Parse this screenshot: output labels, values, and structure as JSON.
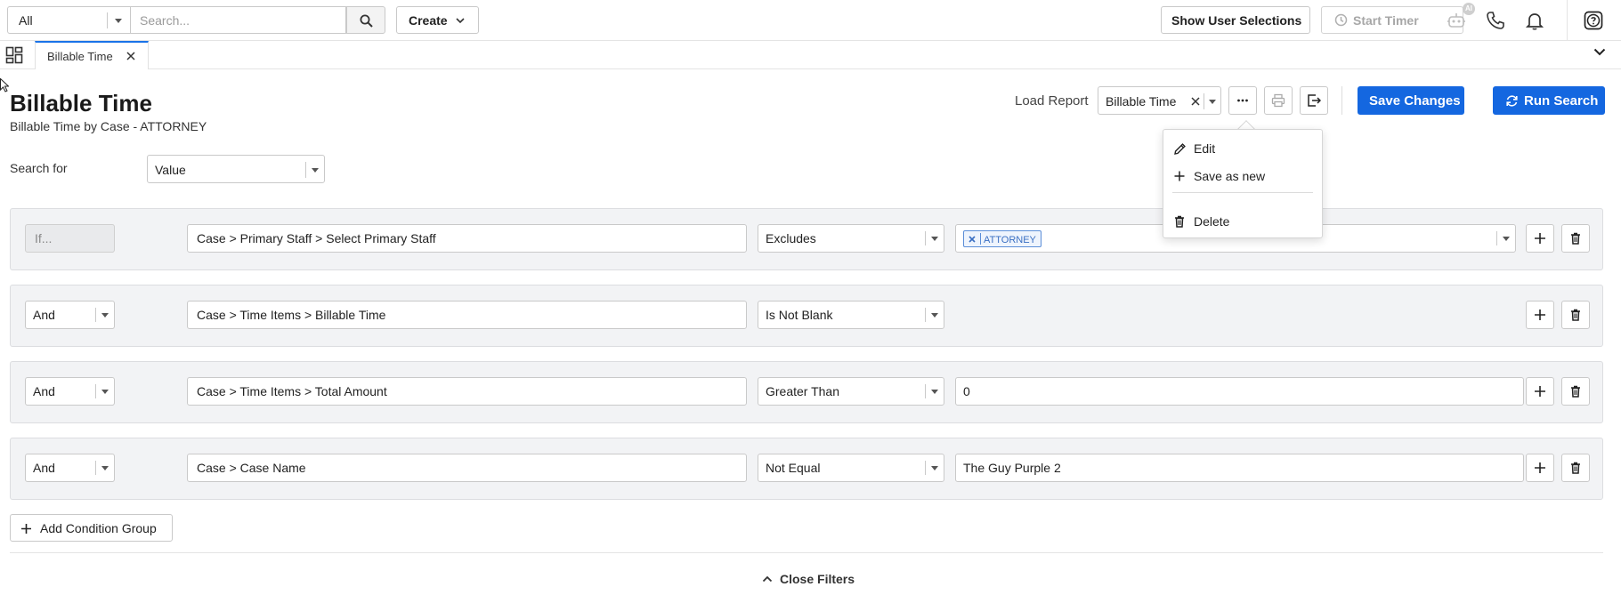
{
  "topbar": {
    "scope_value": "All",
    "search_placeholder": "Search...",
    "create_label": "Create",
    "show_user_selections_label": "Show User Selections",
    "start_timer_label": "Start Timer",
    "ai_badge": "AI"
  },
  "tabs": [
    {
      "label": "Billable Time",
      "active": true
    }
  ],
  "header": {
    "title": "Billable Time",
    "subtitle": "Billable Time by Case - ATTORNEY",
    "load_report_label": "Load Report",
    "report_value": "Billable Time",
    "save_changes_label": "Save Changes",
    "run_search_label": "Run Search"
  },
  "search_for": {
    "label": "Search for",
    "value": "Value"
  },
  "conditions": [
    {
      "logic": "If...",
      "field": "Case > Primary Staff > Select Primary Staff",
      "operator": "Excludes",
      "chip": "ATTORNEY",
      "value": ""
    },
    {
      "logic": "And",
      "field": "Case > Time Items > Billable Time",
      "operator": "Is Not Blank",
      "value": ""
    },
    {
      "logic": "And",
      "field": "Case > Time Items > Total Amount",
      "operator": "Greater Than",
      "value": "0"
    },
    {
      "logic": "And",
      "field": "Case > Case Name",
      "operator": "Not Equal",
      "value": "The Guy Purple 2"
    }
  ],
  "footer": {
    "add_condition_group_label": "Add Condition Group",
    "close_filters_label": "Close Filters"
  },
  "menu": {
    "edit_label": "Edit",
    "save_as_new_label": "Save as new",
    "delete_label": "Delete"
  },
  "colors": {
    "primary": "#1467e0",
    "tab_accent": "#1a73e8",
    "row_bg": "#f2f3f5",
    "chip_border": "#5b8ed8"
  },
  "icons": [
    "search-icon",
    "chevron-down-icon",
    "clock-icon",
    "robot-icon",
    "phone-icon",
    "bell-icon",
    "help-icon",
    "grid-icon",
    "close-icon",
    "ellipsis-icon",
    "print-icon",
    "export-icon",
    "refresh-icon",
    "plus-icon",
    "trash-icon",
    "pencil-icon",
    "chevron-up-icon"
  ]
}
